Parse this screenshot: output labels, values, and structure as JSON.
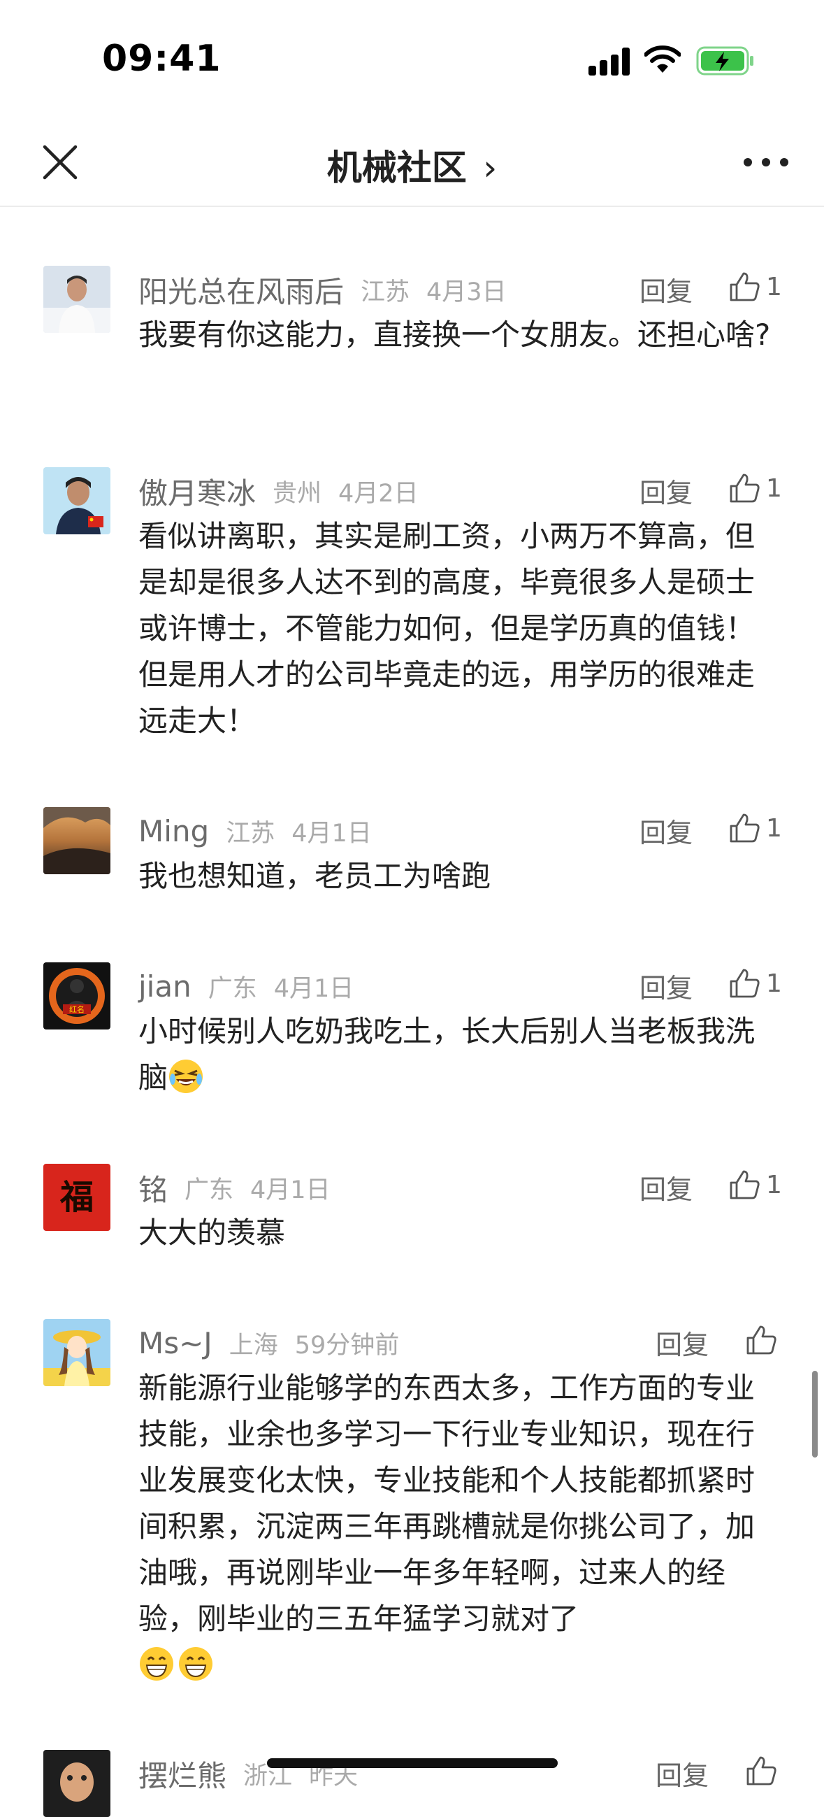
{
  "status_bar": {
    "time": "09:41"
  },
  "nav": {
    "title": "机械社区",
    "title_chevron": "›"
  },
  "comments": [
    {
      "username": "阳光总在风雨后",
      "location": "江苏",
      "date": "4月3日",
      "reply_label": "回复",
      "likes": "1",
      "text": "我要有你这能力，直接换一个女朋友。还担心啥?"
    },
    {
      "username": "傲月寒冰",
      "location": "贵州",
      "date": "4月2日",
      "reply_label": "回复",
      "likes": "1",
      "text": "看似讲离职，其实是刷工资，小两万不算高，但是却是很多人达不到的高度，毕竟很多人是硕士或许博士，不管能力如何，但是学历真的值钱！但是用人才的公司毕竟走的远，用学历的很难走远走大！"
    },
    {
      "username": "Ming",
      "location": "江苏",
      "date": "4月1日",
      "reply_label": "回复",
      "likes": "1",
      "text": "我也想知道，老员工为啥跑"
    },
    {
      "username": "jian",
      "location": "广东",
      "date": "4月1日",
      "reply_label": "回复",
      "likes": "1",
      "text": "小时候别人吃奶我吃土，长大后别人当老板我洗脑"
    },
    {
      "username": "铭",
      "location": "广东",
      "date": "4月1日",
      "reply_label": "回复",
      "likes": "1",
      "text": "大大的羡慕"
    },
    {
      "username": "Ms~J",
      "location": "上海",
      "date": "59分钟前",
      "reply_label": "回复",
      "likes": "",
      "text": "新能源行业能够学的东西太多，工作方面的专业技能，业余也多学习一下行业专业知识，现在行业发展变化太快，专业技能和个人技能都抓紧时间积累，沉淀两三年再跳槽就是你挑公司了，加油哦，再说刚毕业一年多年轻啊，过来人的经验，刚毕业的三五年猛学习就对了"
    },
    {
      "username": "摆烂熊",
      "location": "浙江",
      "date": "昨天",
      "reply_label": "回复",
      "likes": ""
    }
  ],
  "icons": {
    "close": "close-icon",
    "more": "more-icon",
    "like": "thumbs-up-icon",
    "emoji_laugh": "laughing-tears-emoji",
    "emoji_grin": "grinning-emoji"
  },
  "colors": {
    "battery": "#3cc24a",
    "username": "#6b6b6b",
    "meta": "#aaaaaa"
  }
}
